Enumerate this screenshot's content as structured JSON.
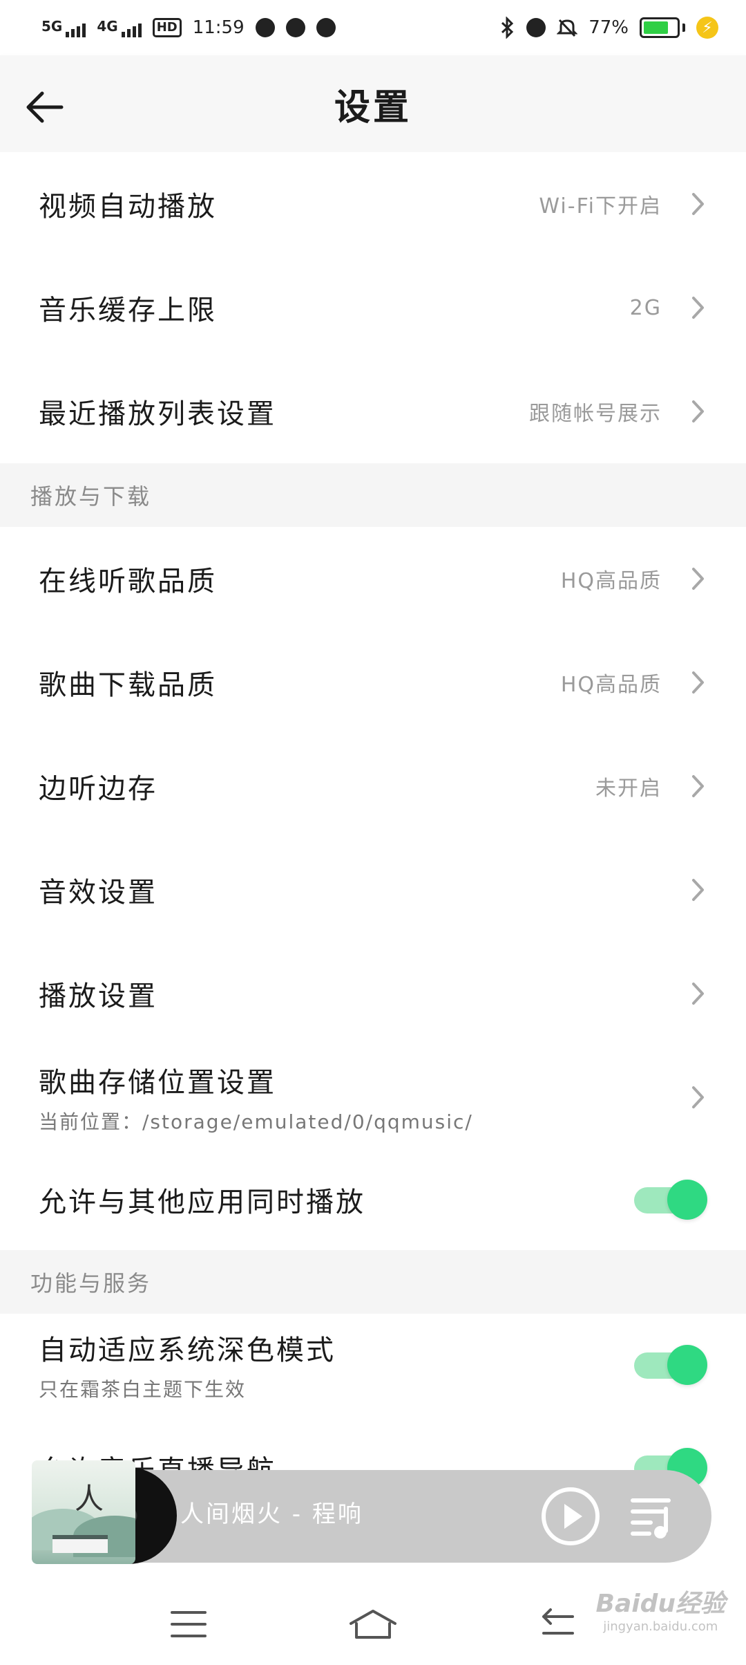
{
  "status_bar": {
    "net1": "5G",
    "net2": "4G",
    "hd": "HD",
    "time": "11:59",
    "battery": "77%",
    "battery_level": 0.77
  },
  "header": {
    "title": "设置"
  },
  "rows_top": [
    {
      "label": "视频自动播放",
      "value": "Wi-Fi下开启"
    },
    {
      "label": "音乐缓存上限",
      "value": "2G"
    },
    {
      "label": "最近播放列表设置",
      "value": "跟随帐号展示"
    }
  ],
  "sections": {
    "playback": "播放与下载",
    "features": "功能与服务"
  },
  "rows_playback": [
    {
      "label": "在线听歌品质",
      "value": "HQ高品质"
    },
    {
      "label": "歌曲下载品质",
      "value": "HQ高品质"
    },
    {
      "label": "边听边存",
      "value": "未开启"
    },
    {
      "label": "音效设置",
      "value": ""
    },
    {
      "label": "播放设置",
      "value": ""
    }
  ],
  "storage_row": {
    "label": "歌曲存储位置设置",
    "sub": "当前位置：/storage/emulated/0/qqmusic/"
  },
  "allow_row": {
    "label": "允许与其他应用同时播放",
    "on": true
  },
  "dark_row": {
    "label": "自动适应系统深色模式",
    "sub": "只在霜茶白主题下生效",
    "on": true
  },
  "live_row": {
    "label": "允许音乐直播导航",
    "on": true
  },
  "player": {
    "song": "人间烟火 - 程响",
    "cover_glyph": "人"
  },
  "watermark": {
    "brand": "Baidu经验",
    "url": "jingyan.baidu.com"
  },
  "colors": {
    "accent": "#2fd982",
    "track": "#9ee8bd",
    "player_bg": "#c9c9c9"
  },
  "icons": {
    "back": "arrow-left-icon",
    "chevron": "chevron-right-icon",
    "play": "play-icon",
    "queue": "playlist-icon",
    "menu": "menu-icon",
    "home": "home-icon",
    "recent": "back-nav-icon"
  }
}
